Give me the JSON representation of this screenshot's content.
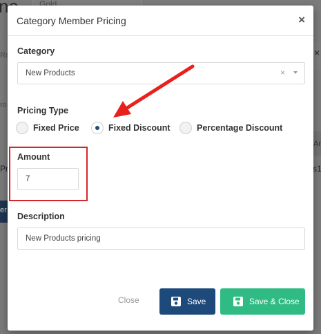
{
  "background": {
    "heading_fragment": "ne",
    "input_value": "Gold",
    "left_fragment_1": "Re",
    "left_fragment_2": "ro",
    "right_close": "×",
    "right_header_fragment": "Ar",
    "left_row_fragment": "Pr",
    "right_row_fragment": "s1",
    "left_button_fragment": "er"
  },
  "modal": {
    "title": "Category Member Pricing",
    "close_icon": "×",
    "category": {
      "label": "Category",
      "value": "New Products",
      "clear_icon": "×"
    },
    "pricing_type": {
      "label": "Pricing Type",
      "options": [
        {
          "label": "Fixed Price",
          "checked": false
        },
        {
          "label": "Fixed Discount",
          "checked": true
        },
        {
          "label": "Percentage Discount",
          "checked": false
        }
      ]
    },
    "amount": {
      "label": "Amount",
      "value": "7"
    },
    "description": {
      "label": "Description",
      "value": "New Products pricing"
    },
    "footer": {
      "close_label": "Close",
      "save_label": "Save",
      "save_close_label": "Save & Close"
    }
  },
  "annotations": {
    "highlight_color": "#d7262a",
    "arrow_color": "#e8211d"
  }
}
